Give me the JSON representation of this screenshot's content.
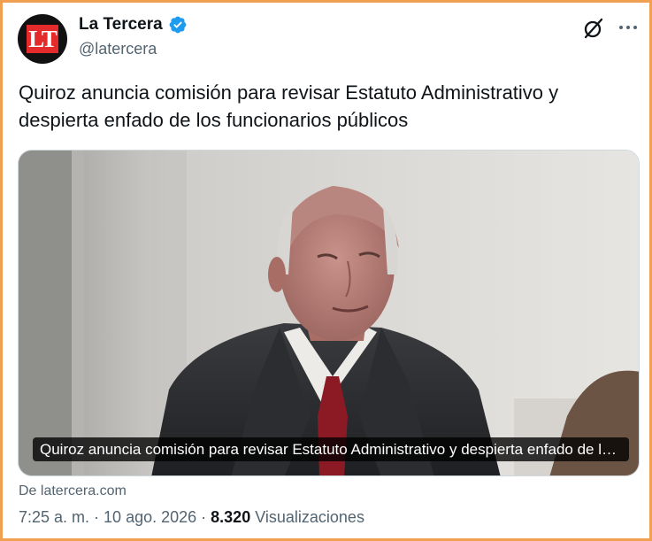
{
  "author": {
    "display_name": "La Tercera",
    "handle": "@latercera",
    "avatar_text": "LT",
    "verified": true
  },
  "tweet": {
    "text": "Quiroz anuncia comisión para revisar Estatuto Administrativo y despierta enfado de los funcionarios públicos"
  },
  "card": {
    "caption": "Quiroz anuncia comisión para revisar Estatuto Administrativo y despierta enfado de los funcionarios públicos",
    "source": "De latercera.com"
  },
  "meta": {
    "time": "7:25 a. m.",
    "separator": " · ",
    "date": "10 ago. 2026",
    "views_count": "8.320",
    "views_label": " Visualizaciones"
  },
  "icons": {
    "grok": "grok-icon",
    "more": "more-icon",
    "verified": "verified-badge-icon"
  },
  "colors": {
    "border": "#f0a050",
    "verified": "#1d9bf0",
    "secondary_text": "#536471",
    "brand_red": "#e32b2b"
  }
}
